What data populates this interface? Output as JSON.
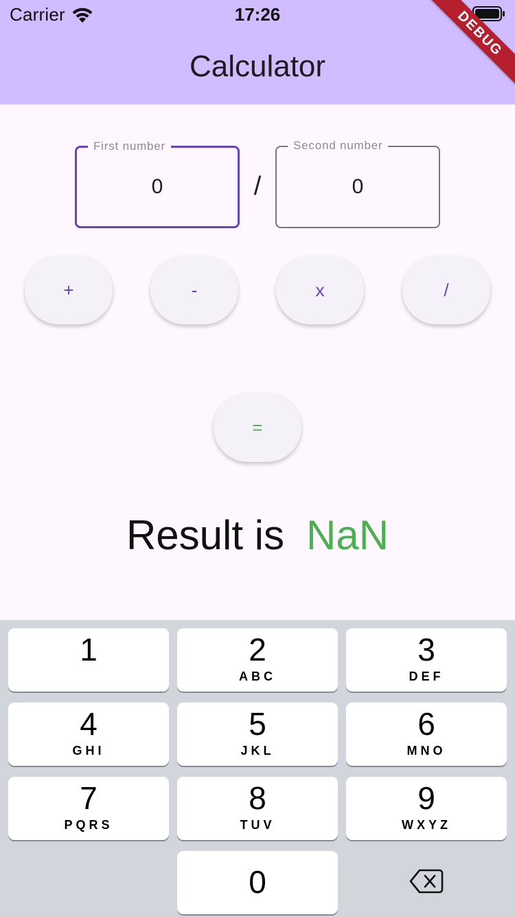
{
  "status_bar": {
    "carrier": "Carrier",
    "time": "17:26"
  },
  "debug_banner": "DEBUG",
  "app_bar": {
    "title": "Calculator"
  },
  "inputs": {
    "first": {
      "label": "First number",
      "value": "0"
    },
    "second": {
      "label": "Second number",
      "value": "0"
    },
    "operator": "/"
  },
  "operator_buttons": [
    "+",
    "-",
    "x",
    "/"
  ],
  "equals_button": "=",
  "result": {
    "label": "Result is",
    "value": "NaN"
  },
  "keyboard": {
    "keys": [
      {
        "digit": "1",
        "letters": ""
      },
      {
        "digit": "2",
        "letters": "ABC"
      },
      {
        "digit": "3",
        "letters": "DEF"
      },
      {
        "digit": "4",
        "letters": "GHI"
      },
      {
        "digit": "5",
        "letters": "JKL"
      },
      {
        "digit": "6",
        "letters": "MNO"
      },
      {
        "digit": "7",
        "letters": "PQRS"
      },
      {
        "digit": "8",
        "letters": "TUV"
      },
      {
        "digit": "9",
        "letters": "WXYZ"
      },
      {
        "digit": "0",
        "letters": ""
      }
    ],
    "delete_icon": "backspace-icon"
  },
  "colors": {
    "app_bar": "#d1bcff",
    "primary": "#6a43b8",
    "result_value": "#4caf50",
    "background": "#fef7ff",
    "keyboard": "#d2d5db"
  }
}
